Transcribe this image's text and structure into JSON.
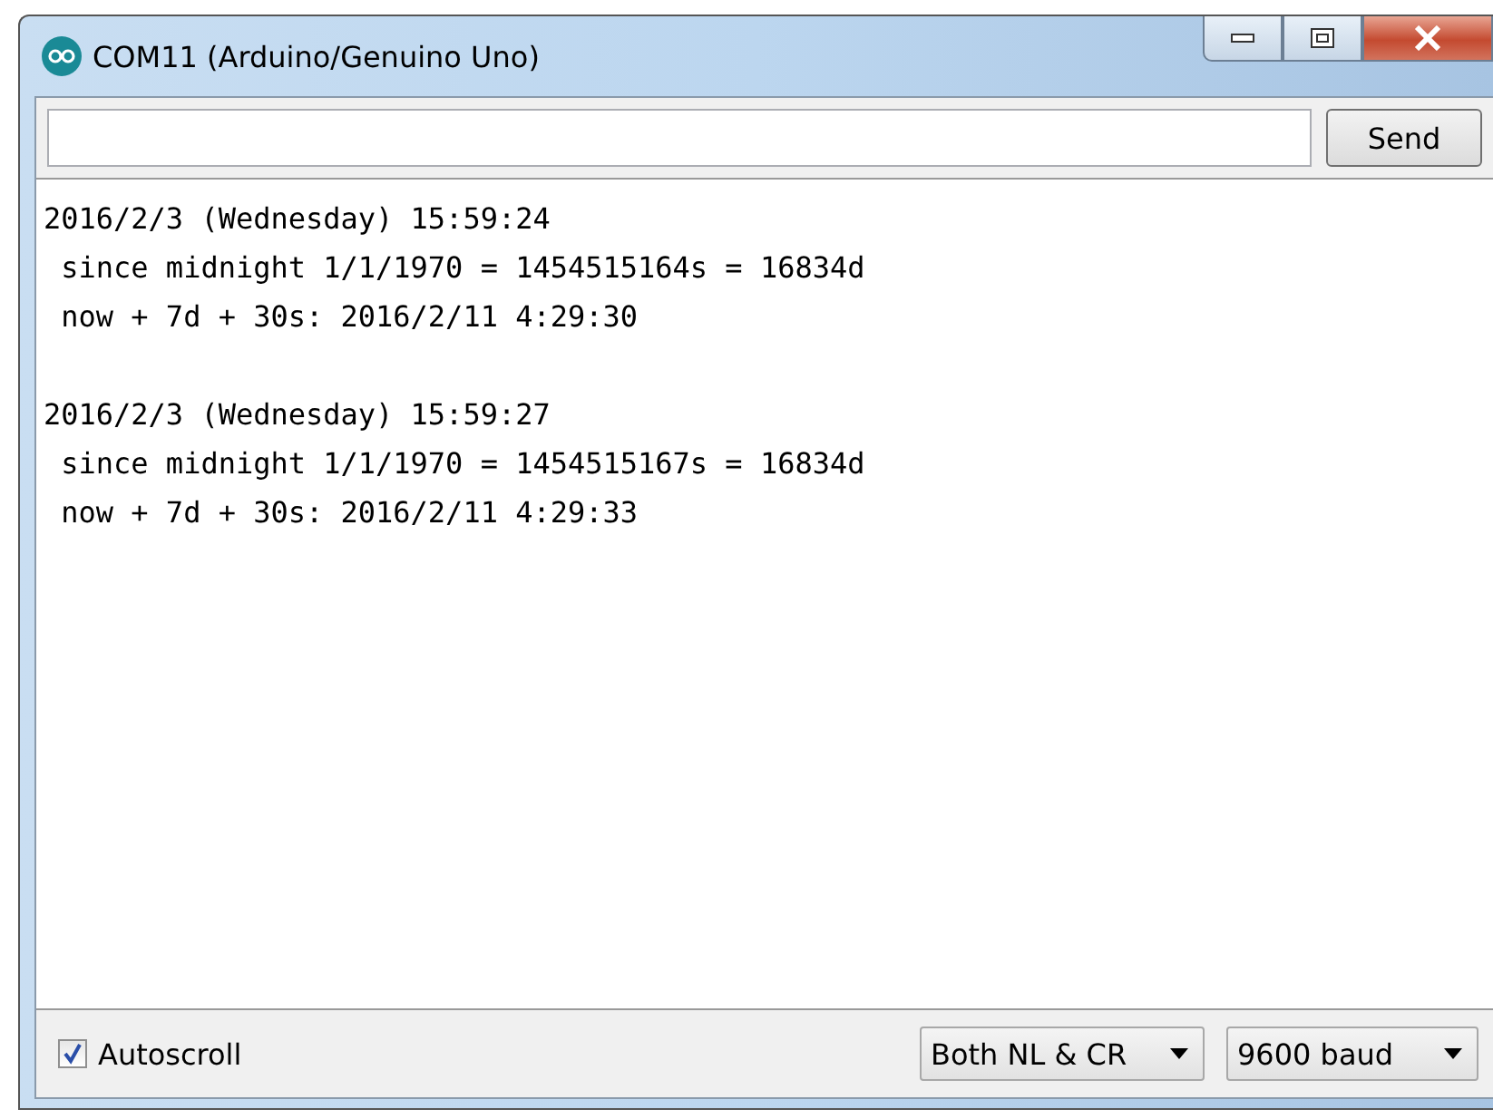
{
  "window": {
    "title": "COM11 (Arduino/Genuino Uno)"
  },
  "send_bar": {
    "button": "Send"
  },
  "output": [
    {
      "lines": [
        "2016/2/3 (Wednesday) 15:59:24",
        " since midnight 1/1/1970 = 1454515164s = 16834d",
        " now + 7d + 30s: 2016/2/11 4:29:30"
      ]
    },
    {
      "lines": [
        "2016/2/3 (Wednesday) 15:59:27",
        " since midnight 1/1/1970 = 1454515167s = 16834d",
        " now + 7d + 30s: 2016/2/11 4:29:33"
      ]
    }
  ],
  "status_bar": {
    "autoscroll": {
      "label": "Autoscroll",
      "checked": true
    },
    "line_ending": "Both NL & CR",
    "baud_rate": "9600 baud"
  }
}
